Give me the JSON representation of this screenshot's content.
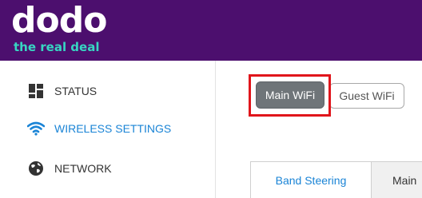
{
  "header": {
    "logo_text": "dodo",
    "tagline": "the real deal",
    "background_color": "#4c0f6e",
    "tagline_color": "#37d6c2"
  },
  "sidebar": {
    "items": [
      {
        "label": "STATUS",
        "icon": "dashboard-icon",
        "active": false
      },
      {
        "label": "WIRELESS SETTINGS",
        "icon": "wifi-icon",
        "active": true
      },
      {
        "label": "NETWORK",
        "icon": "globe-icon",
        "active": false
      }
    ],
    "active_color": "#1a84d6"
  },
  "main": {
    "wifi_buttons": {
      "main_label": "Main WiFi",
      "guest_label": "Guest WiFi",
      "selected": "Main WiFi"
    },
    "highlight_color": "#e0151b",
    "tabs": [
      {
        "label": "Band Steering",
        "active": true
      },
      {
        "label": "Main",
        "active": false
      }
    ]
  }
}
